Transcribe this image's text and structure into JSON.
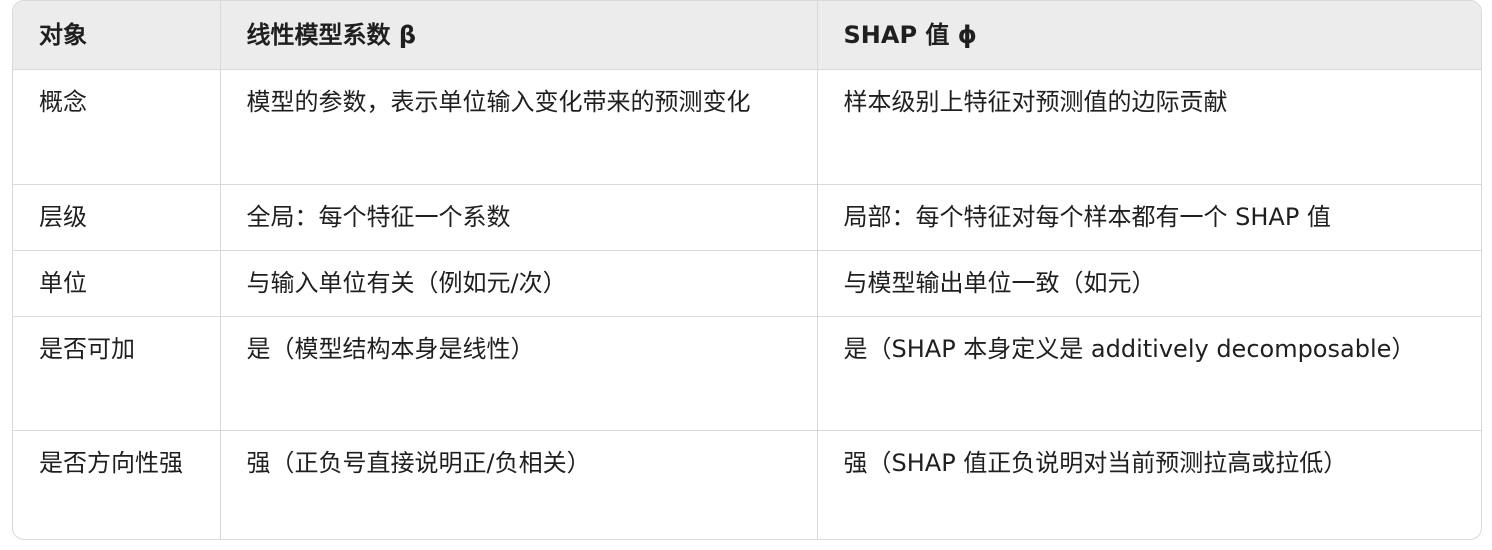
{
  "table": {
    "headers": [
      "对象",
      "线性模型系数 β",
      "SHAP 值 ϕ"
    ],
    "rows": [
      [
        "概念",
        "模型的参数，表示单位输入变化带来的预测变化",
        "样本级别上特征对预测值的边际贡献"
      ],
      [
        "层级",
        "全局：每个特征一个系数",
        "局部：每个特征对每个样本都有一个 SHAP 值"
      ],
      [
        "单位",
        "与输入单位有关（例如元/次）",
        "与模型输出单位一致（如元）"
      ],
      [
        "是否可加",
        "是（模型结构本身是线性）",
        "是（SHAP 本身定义是 additively decomposable）"
      ],
      [
        "是否方向性强",
        "强（正负号直接说明正/负相关）",
        "强（SHAP 值正负说明对当前预测拉高或拉低）"
      ]
    ]
  }
}
